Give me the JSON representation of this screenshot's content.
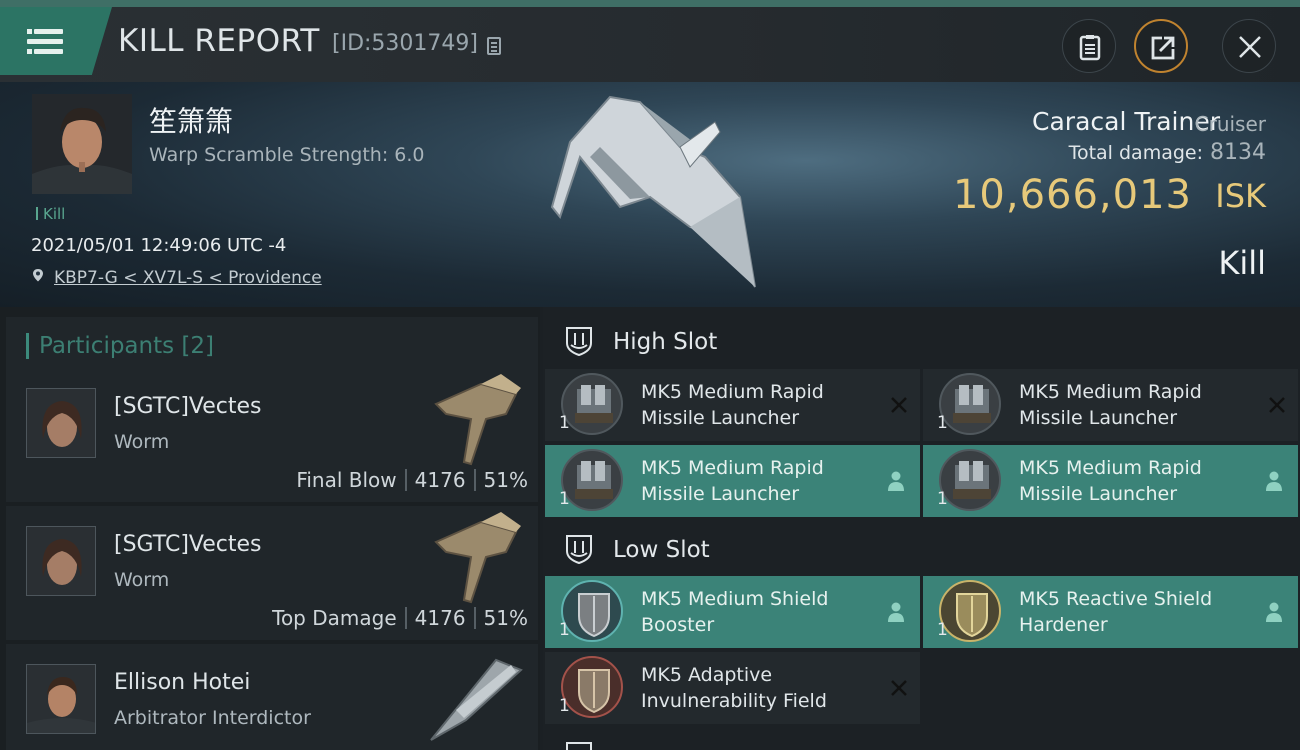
{
  "header": {
    "title": "KILL REPORT",
    "kill_id": "[ID:5301749]"
  },
  "victim": {
    "pilot_name": "笙箫箫",
    "warp_scramble": "Warp Scramble Strength: 6.0",
    "kill_tag": "Kill",
    "datetime": "2021/05/01 12:49:06 UTC -4",
    "location": "KBP7-G < XV7L-S < Providence",
    "ship_name": "Caracal Trainer",
    "ship_class": "Cruiser",
    "total_damage_label": "Total damage:",
    "total_damage": "8134",
    "isk_value": "10,666,013",
    "isk_unit": "ISK",
    "result": "Kill"
  },
  "participants": {
    "title": "Participants",
    "count": "[2]",
    "rows": [
      {
        "name": "[SGTC]Vectes",
        "ship": "Worm",
        "role": "Final Blow",
        "damage": "4176",
        "percent": "51%"
      },
      {
        "name": "[SGTC]Vectes",
        "ship": "Worm",
        "role": "Top Damage",
        "damage": "4176",
        "percent": "51%"
      },
      {
        "name": "Ellison Hotei",
        "ship": "Arbitrator Interdictor",
        "role": "",
        "damage": "",
        "percent": ""
      }
    ]
  },
  "fitting": {
    "high_slot_title": "High Slot",
    "low_slot_title": "Low Slot",
    "high": [
      {
        "line1": "MK5 Medium Rapid",
        "line2": "Missile Launcher",
        "qty": "1",
        "state": "destroyed"
      },
      {
        "line1": "MK5 Medium Rapid",
        "line2": "Missile Launcher",
        "qty": "1",
        "state": "destroyed"
      },
      {
        "line1": "MK5 Medium Rapid",
        "line2": "Missile Launcher",
        "qty": "1",
        "state": "dropped"
      },
      {
        "line1": "MK5 Medium Rapid",
        "line2": "Missile Launcher",
        "qty": "1",
        "state": "dropped"
      }
    ],
    "low": [
      {
        "line1": "MK5 Medium Shield",
        "line2": "Booster",
        "qty": "1",
        "state": "dropped"
      },
      {
        "line1": "MK5 Reactive Shield",
        "line2": "Hardener",
        "qty": "1",
        "state": "dropped"
      },
      {
        "line1": "MK5 Adaptive",
        "line2": "Invulnerability Field",
        "qty": "1",
        "state": "destroyed"
      }
    ]
  },
  "colors": {
    "accent": "#2c7464",
    "isk": "#e7c97a",
    "dropped_bg": "#3b8378"
  }
}
